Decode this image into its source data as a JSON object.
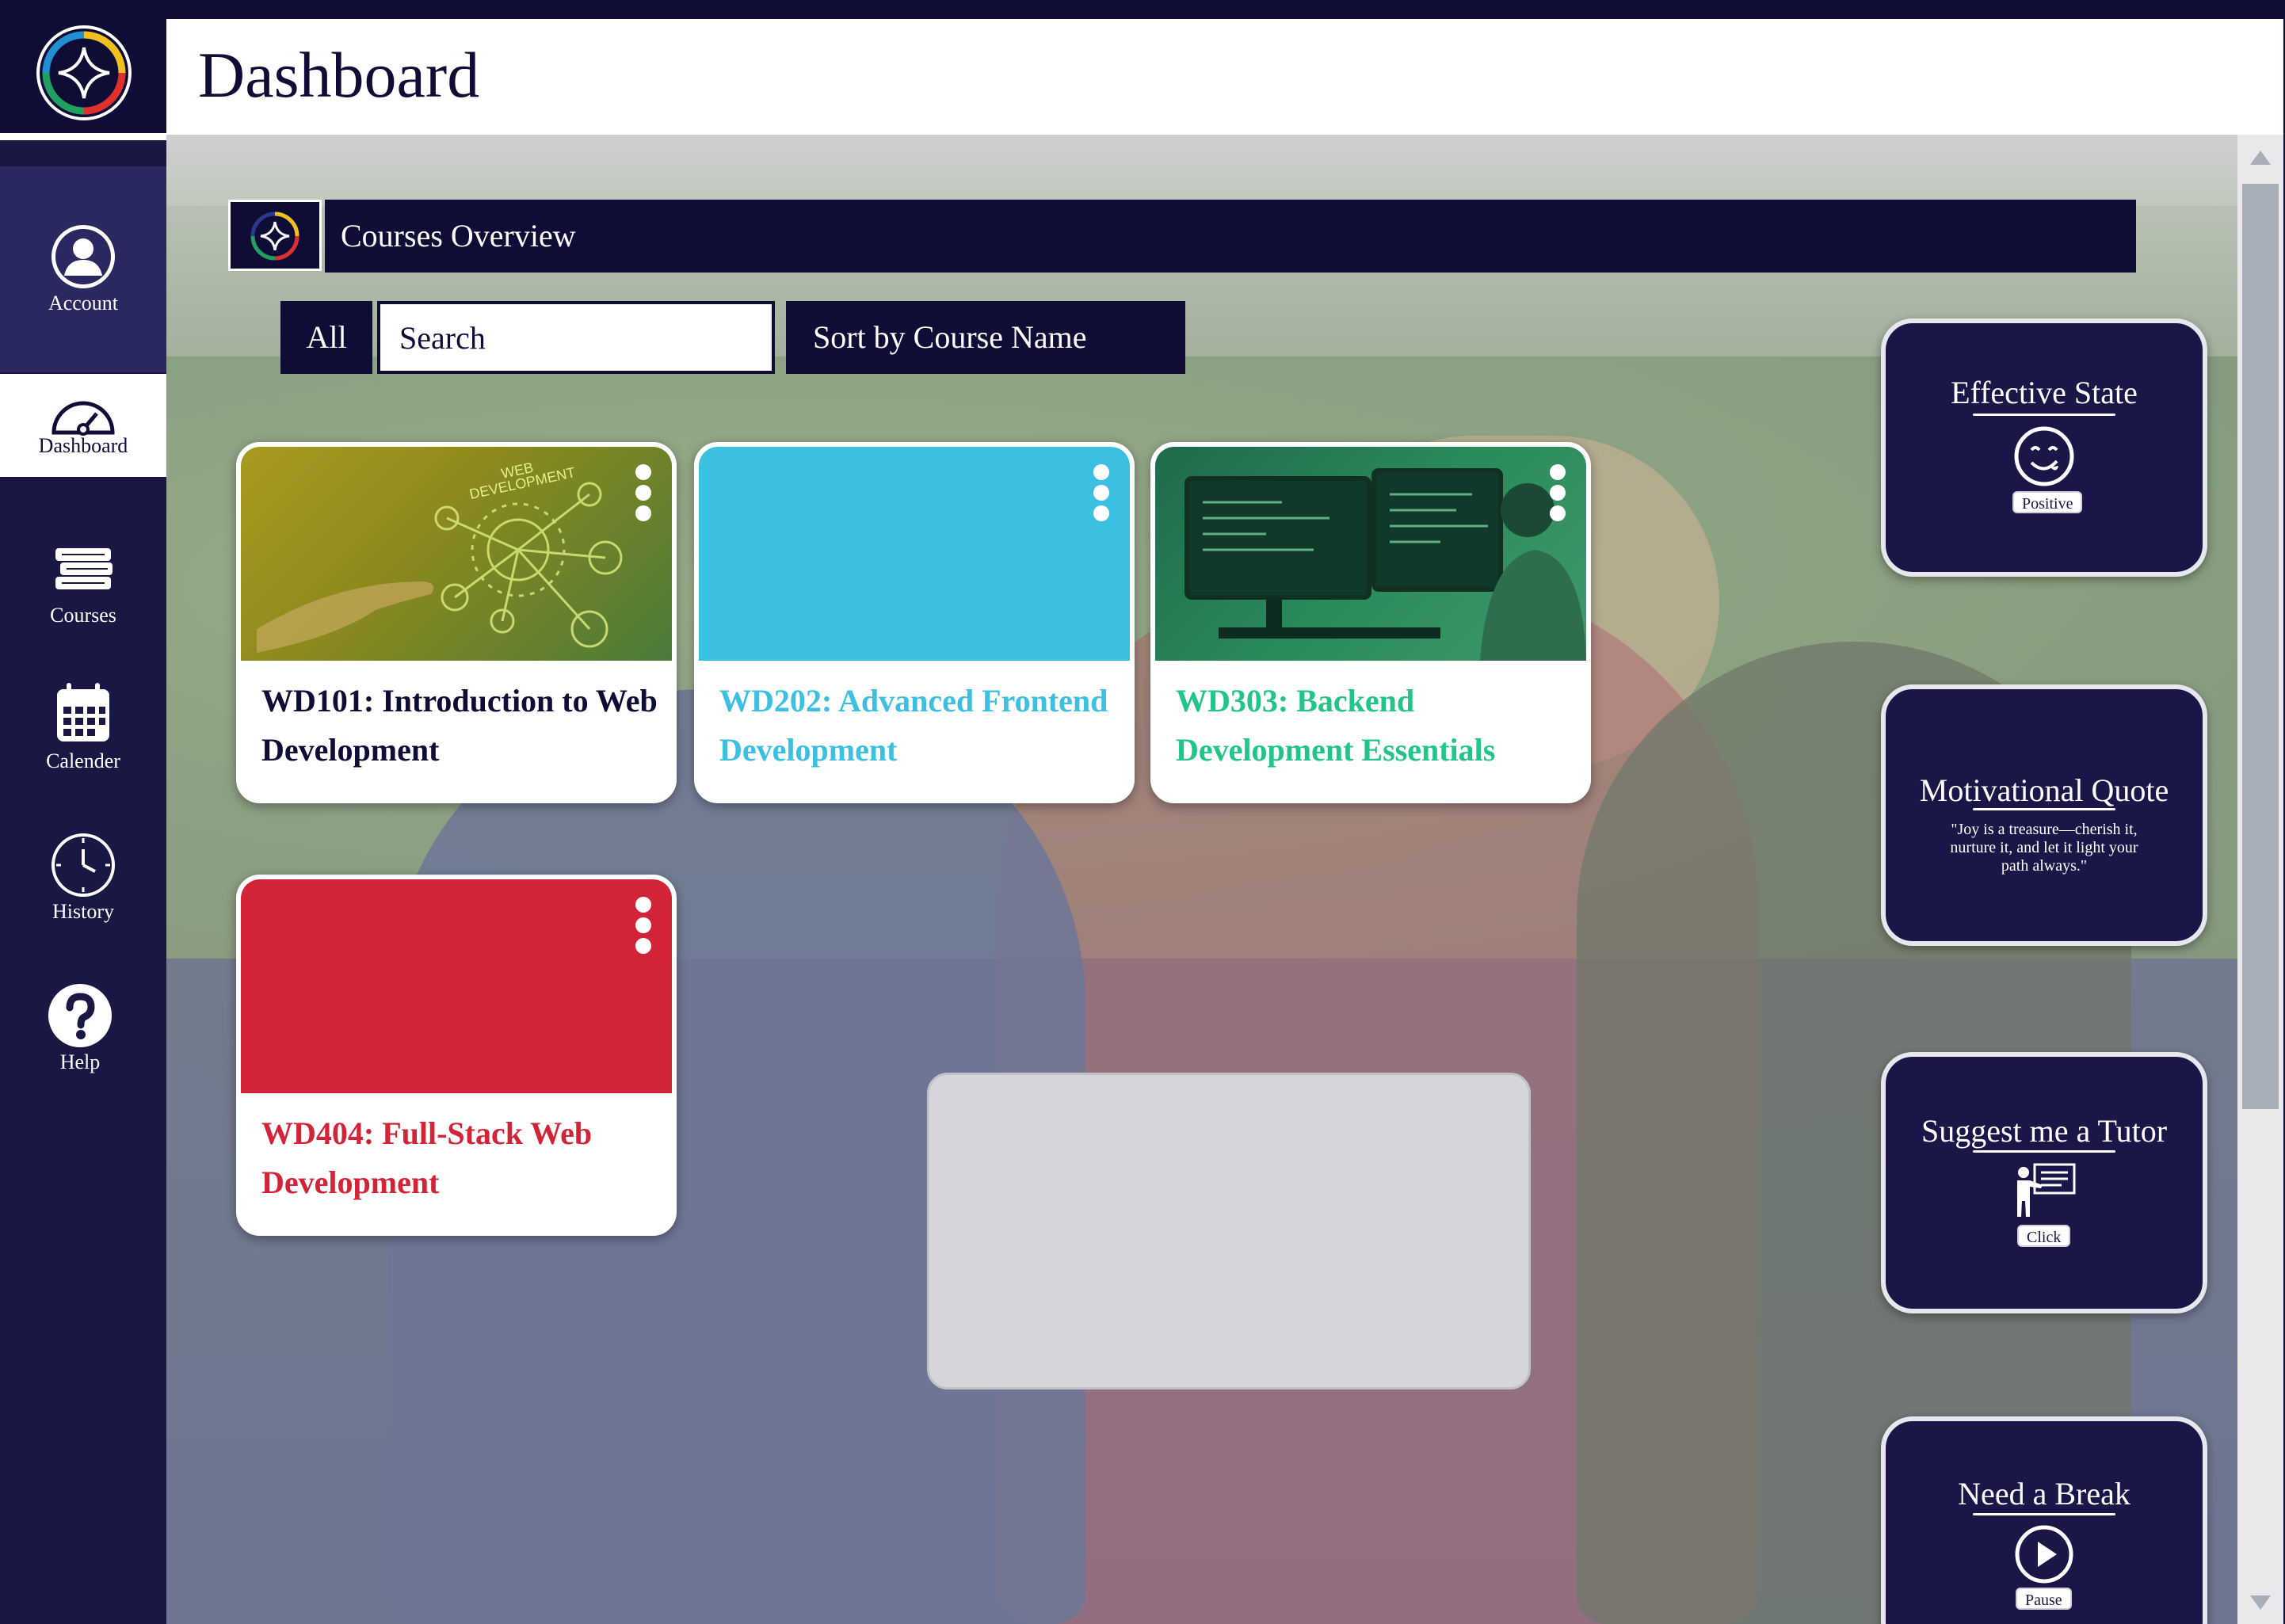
{
  "header": {
    "title": "Dashboard"
  },
  "sidebar": {
    "items": [
      {
        "id": "account",
        "label": "Account",
        "icon": "user-icon"
      },
      {
        "id": "dashboard",
        "label": "Dashboard",
        "icon": "gauge-icon",
        "active": true
      },
      {
        "id": "courses",
        "label": "Courses",
        "icon": "books-icon"
      },
      {
        "id": "calender",
        "label": "Calender",
        "icon": "calendar-icon"
      },
      {
        "id": "history",
        "label": "History",
        "icon": "clock-icon"
      },
      {
        "id": "help",
        "label": "Help",
        "icon": "help-icon"
      }
    ]
  },
  "overview": {
    "title": "Courses Overview"
  },
  "filters": {
    "all_label": "All",
    "search_placeholder": "Search",
    "sort_label": "Sort by Course Name"
  },
  "courses": [
    {
      "title": "WD101: Introduction to Web Development",
      "color": "#0f0c36",
      "thumbnail": "web-development-image"
    },
    {
      "title": "WD202: Advanced Frontend Development",
      "color": "#3cc0e2",
      "thumbnail": "solid-cyan"
    },
    {
      "title": "WD303: Backend Development Essentials",
      "color": "#21c58a",
      "thumbnail": "developer-at-monitors-image"
    },
    {
      "title": "WD404: Full-Stack Web Development",
      "color": "#d32337",
      "thumbnail": "solid-red"
    }
  ],
  "widgets": {
    "effective_state": {
      "title": "Effective State",
      "status": "Positive",
      "icon": "smiley-icon"
    },
    "motivational_quote": {
      "title": "Motivational Quote",
      "quote": "\"Joy is a treasure—cherish it, nurture it, and let it light your path always.\""
    },
    "tutor": {
      "title": "Suggest me a Tutor",
      "button": "Click",
      "icon": "tutor-icon"
    },
    "break": {
      "title": "Need a Break",
      "button": "Pause",
      "icon": "play-icon"
    }
  },
  "colors": {
    "navy": "#0f0c36",
    "sidebar": "#191744",
    "cyan": "#3cc0e2",
    "green": "#21c58a",
    "red": "#d32337"
  }
}
